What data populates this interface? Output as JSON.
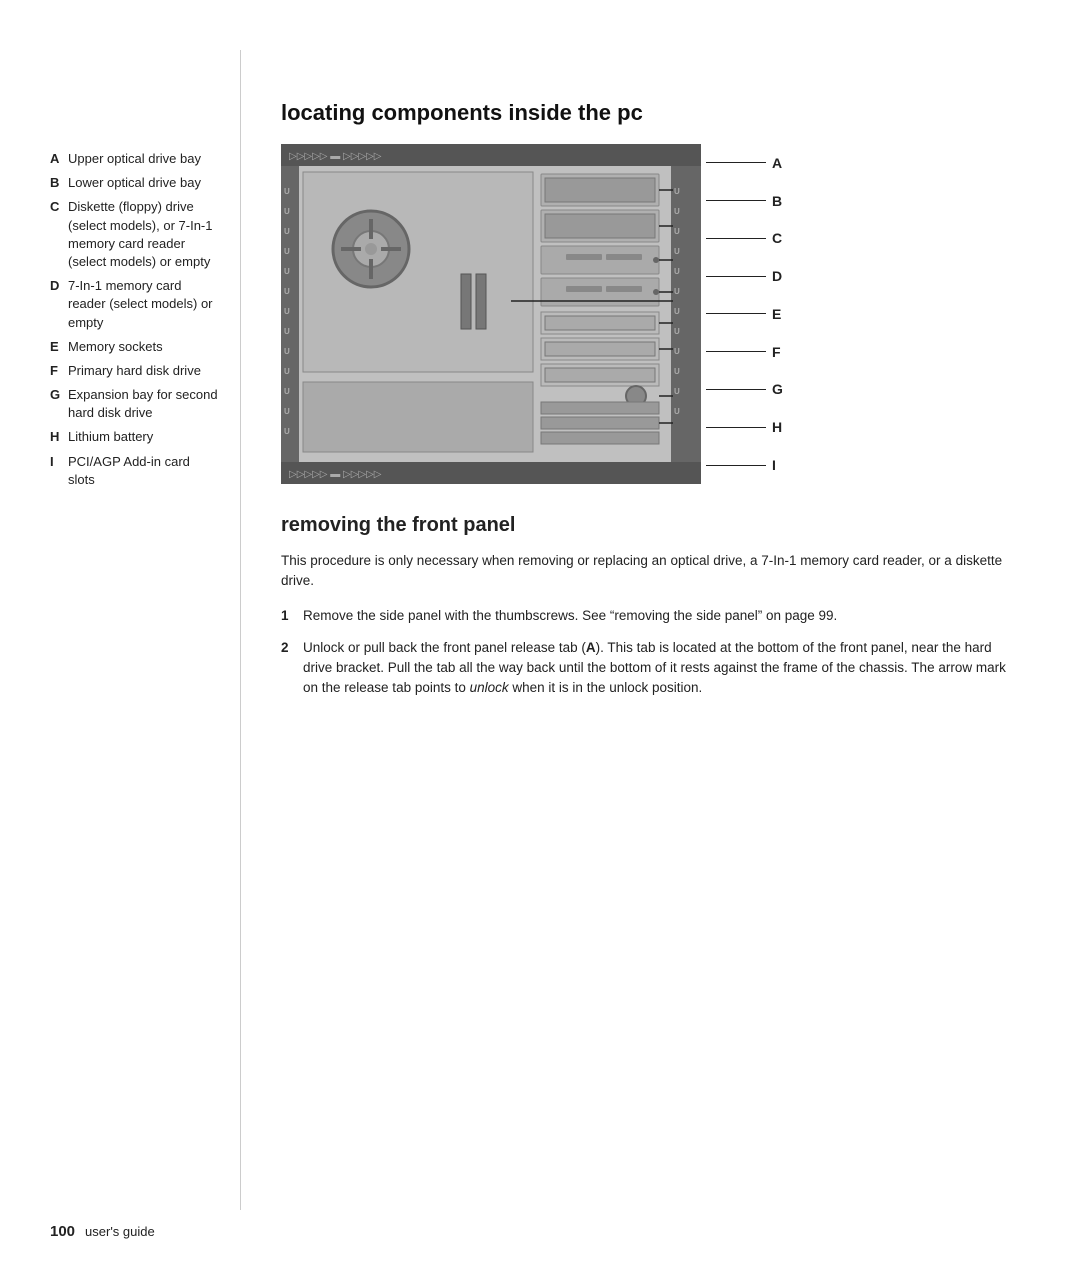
{
  "page": {
    "number": "100",
    "label": "user's guide"
  },
  "section1": {
    "title": "locating components inside the pc"
  },
  "sidebar": {
    "items": [
      {
        "letter": "A",
        "text": "Upper optical drive bay"
      },
      {
        "letter": "B",
        "text": "Lower optical drive bay"
      },
      {
        "letter": "C",
        "text": "Diskette (floppy) drive (select models), or 7-In-1 memory card reader (select models) or empty"
      },
      {
        "letter": "D",
        "text": "7-In-1 memory card reader (select models) or empty"
      },
      {
        "letter": "E",
        "text": "Memory sockets"
      },
      {
        "letter": "F",
        "text": "Primary hard disk drive"
      },
      {
        "letter": "G",
        "text": "Expansion bay for second hard disk drive"
      },
      {
        "letter": "H",
        "text": "Lithium battery"
      },
      {
        "letter": "I",
        "text": "PCI/AGP Add-in card slots"
      }
    ]
  },
  "diagram_labels": [
    "A",
    "B",
    "C",
    "D",
    "E",
    "F",
    "G",
    "H",
    "I"
  ],
  "section2": {
    "title": "removing the front panel",
    "intro": "This procedure is only necessary when removing or replacing an optical drive, a 7-In-1 memory card reader, or a diskette drive.",
    "steps": [
      {
        "num": "1",
        "text": "Remove the side panel with the thumbscrews. See “removing the side panel” on page 99."
      },
      {
        "num": "2",
        "text": "Unlock or pull back the front panel release tab (A). This tab is located at the bottom of the front panel, near the hard drive bracket. Pull the tab all the way back until the bottom of it rests against the frame of the chassis. The arrow mark on the release tab points to unlock when it is in the unlock position."
      }
    ],
    "italic_word": "unlock"
  }
}
